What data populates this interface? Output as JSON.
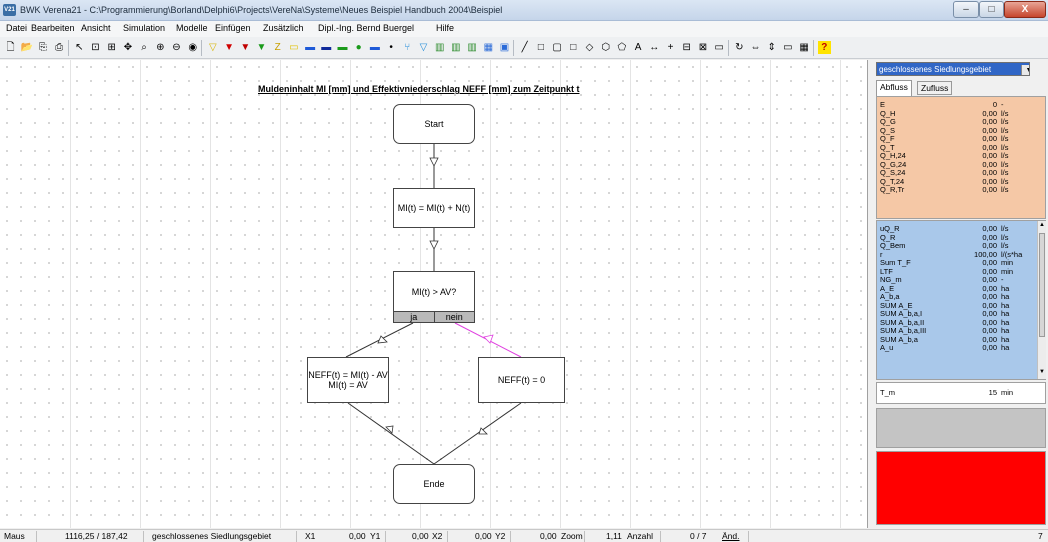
{
  "window": {
    "app_icon": "V21",
    "title": "BWK Verena21 - C:\\Programmierung\\Borland\\Delphi6\\Projects\\VereNa\\Systeme\\Neues Beispiel Handbuch 2004\\Beispiel",
    "minimize": "–",
    "maximize": "□",
    "close": "X"
  },
  "menu": [
    "Datei",
    "Bearbeiten",
    "Ansicht",
    "Simulation",
    "Modelle",
    "Einfügen",
    "Zusätzlich",
    "Dipl.-Ing. Bernd Buergel",
    "Hilfe"
  ],
  "toolbar_icons": [
    {
      "name": "new-file-icon",
      "glyph": "🗋"
    },
    {
      "name": "open-folder-icon",
      "glyph": "📂"
    },
    {
      "name": "copy-icon",
      "glyph": "⎘"
    },
    {
      "name": "print-icon",
      "glyph": "⎙"
    },
    {
      "name": "pointer-icon",
      "glyph": "↖"
    },
    {
      "name": "zoom-select-icon",
      "glyph": "⊡"
    },
    {
      "name": "zoom-window-icon",
      "glyph": "⊞"
    },
    {
      "name": "pan-icon",
      "glyph": "✥"
    },
    {
      "name": "zoom-tool-icon",
      "glyph": "⌕"
    },
    {
      "name": "zoom-in-icon",
      "glyph": "⊕"
    },
    {
      "name": "zoom-out-icon",
      "glyph": "⊖"
    },
    {
      "name": "zoom-all-icon",
      "glyph": "◉"
    },
    {
      "name": "triangle-yellow-icon",
      "glyph": "▽"
    },
    {
      "name": "triangle-red-icon",
      "glyph": "▼"
    },
    {
      "name": "triangle-red2-icon",
      "glyph": "▼"
    },
    {
      "name": "triangle-green-icon",
      "glyph": "▼"
    },
    {
      "name": "zigzag-icon",
      "glyph": "Z"
    },
    {
      "name": "rect-yellow-icon",
      "glyph": "▭"
    },
    {
      "name": "rect-blue-icon",
      "glyph": "▬"
    },
    {
      "name": "rect-darkblue-icon",
      "glyph": "▬"
    },
    {
      "name": "rect-green-icon",
      "glyph": "▬"
    },
    {
      "name": "circle-green-icon",
      "glyph": "●"
    },
    {
      "name": "bar-blue-icon",
      "glyph": "▬"
    },
    {
      "name": "dot-icon",
      "glyph": "•"
    },
    {
      "name": "fork-icon",
      "glyph": "⑂"
    },
    {
      "name": "filter-icon",
      "glyph": "▽"
    },
    {
      "name": "chart-green-icon",
      "glyph": "▥"
    },
    {
      "name": "chart-green2-icon",
      "glyph": "▥"
    },
    {
      "name": "chart-green3-icon",
      "glyph": "▥"
    },
    {
      "name": "table-icon",
      "glyph": "▦"
    },
    {
      "name": "save-icon",
      "glyph": "▣"
    },
    {
      "name": "line-icon",
      "glyph": "╱"
    },
    {
      "name": "rectangle-icon",
      "glyph": "□"
    },
    {
      "name": "rounded-rect-icon",
      "glyph": "▢"
    },
    {
      "name": "square-icon",
      "glyph": "□"
    },
    {
      "name": "diamond-icon",
      "glyph": "◇"
    },
    {
      "name": "hexagon-icon",
      "glyph": "⬡"
    },
    {
      "name": "pentagon-icon",
      "glyph": "⬠"
    },
    {
      "name": "text-icon",
      "glyph": "A"
    },
    {
      "name": "double-arrow-icon",
      "glyph": "↔"
    },
    {
      "name": "plus-icon",
      "glyph": "+"
    },
    {
      "name": "split-h-icon",
      "glyph": "⊟"
    },
    {
      "name": "split-v-icon",
      "glyph": "⊠"
    },
    {
      "name": "window-icon",
      "glyph": "▭"
    },
    {
      "name": "rotate-icon",
      "glyph": "↻"
    },
    {
      "name": "flip-h-icon",
      "glyph": "⇔"
    },
    {
      "name": "flip-v-icon",
      "glyph": "⇕"
    },
    {
      "name": "monitor-icon",
      "glyph": "▭"
    },
    {
      "name": "calculator-icon",
      "glyph": "▦"
    },
    {
      "name": "help-icon",
      "glyph": "?"
    }
  ],
  "diagram": {
    "title": "Muldeninhalt MI [mm]  und Effektivniederschlag NEFF [mm] zum Zeitpunkt t",
    "start": "Start",
    "assign": "MI(t) = MI(t) + N(t)",
    "condition": "MI(t) > AV?",
    "yes": "ja",
    "no": "nein",
    "left_line1": "NEFF(t) = MI(t) - AV",
    "left_line2": "MI(t)  = AV",
    "right": "NEFF(t) = 0",
    "end": "Ende"
  },
  "panel": {
    "select_value": "geschlossenes Siedlungsgebiet",
    "tabs": [
      "Abfluss",
      "Zufluss"
    ],
    "orange_rows": [
      {
        "n": "E",
        "v": "0",
        "u": "-"
      },
      {
        "n": "Q_H",
        "v": "0,00",
        "u": "l/s"
      },
      {
        "n": "Q_G",
        "v": "0,00",
        "u": "l/s"
      },
      {
        "n": "Q_S",
        "v": "0,00",
        "u": "l/s"
      },
      {
        "n": "Q_F",
        "v": "0,00",
        "u": "l/s"
      },
      {
        "n": "Q_T",
        "v": "0,00",
        "u": "l/s"
      },
      {
        "n": "Q_H,24",
        "v": "0,00",
        "u": "l/s"
      },
      {
        "n": "Q_G,24",
        "v": "0,00",
        "u": "l/s"
      },
      {
        "n": "Q_S,24",
        "v": "0,00",
        "u": "l/s"
      },
      {
        "n": "Q_T,24",
        "v": "0,00",
        "u": "l/s"
      },
      {
        "n": "Q_R,Tr",
        "v": "0,00",
        "u": "l/s"
      }
    ],
    "blue_rows": [
      {
        "n": "uQ_R",
        "v": "0,00",
        "u": "l/s"
      },
      {
        "n": "Q_R",
        "v": "0,00",
        "u": "l/s"
      },
      {
        "n": "Q_Bem",
        "v": "0,00",
        "u": "l/s"
      },
      {
        "n": "r",
        "v": "100,00",
        "u": "l/(s*ha"
      },
      {
        "n": "Sum T_F",
        "v": "0,00",
        "u": "min"
      },
      {
        "n": "LTF",
        "v": "0,00",
        "u": "min"
      },
      {
        "n": "NG_m",
        "v": "0,00",
        "u": "-"
      },
      {
        "n": "A_E",
        "v": "0,00",
        "u": "ha"
      },
      {
        "n": "A_b,a",
        "v": "0,00",
        "u": "ha"
      },
      {
        "n": "SUM A_E",
        "v": "0,00",
        "u": "ha"
      },
      {
        "n": "SUM A_b,a,I",
        "v": "0,00",
        "u": "ha"
      },
      {
        "n": "SUM A_b,a,II",
        "v": "0,00",
        "u": "ha"
      },
      {
        "n": "SUM A_b,a,III",
        "v": "0,00",
        "u": "ha"
      },
      {
        "n": "SUM A_b,a",
        "v": "0,00",
        "u": "ha"
      },
      {
        "n": "A_u",
        "v": "0,00",
        "u": "ha"
      }
    ],
    "white_row": {
      "n": "T_m",
      "v": "15",
      "u": "min"
    }
  },
  "status": {
    "maus_label": "Maus",
    "maus_value": "1116,25 / 187,42",
    "area": "geschlossenes Siedlungsgebiet",
    "x1_label": "X1",
    "x1_value": "0,00",
    "y1_label": "Y1",
    "y1_value": "0,00",
    "x2_label": "X2",
    "x2_value": "0,00",
    "y2_label": "Y2",
    "y2_value": "0,00",
    "zoom_label": "Zoom",
    "zoom_value": "1,11",
    "anzahl_label": "Anzahl",
    "anzahl_value": "0 / 7",
    "aend_label": "Änd.",
    "right_value": "7"
  },
  "colors": {
    "panel_orange": "#f5c8a6",
    "panel_blue": "#a9c8ea",
    "panel_red": "#ff0000",
    "panel_gray": "#c4c4c4",
    "select_blue": "#3066c6",
    "magenta_connector": "#e040e0"
  }
}
